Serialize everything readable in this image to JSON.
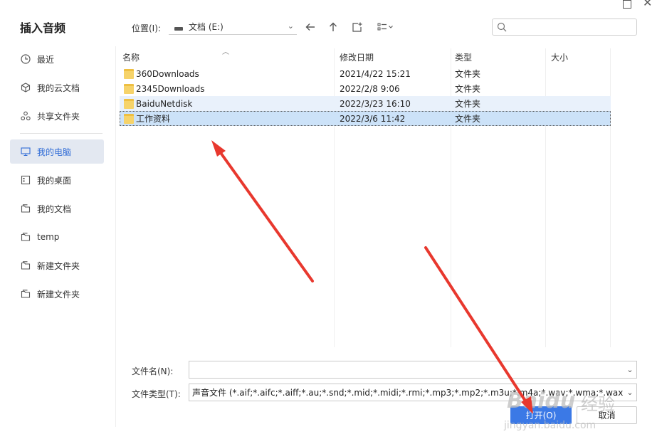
{
  "dialog": {
    "title": "插入音频"
  },
  "sidebar": {
    "items": [
      {
        "label": "最近",
        "icon": "clock-icon"
      },
      {
        "label": "我的云文档",
        "icon": "cloud-cube-icon"
      },
      {
        "label": "共享文件夹",
        "icon": "share-icon"
      },
      {
        "label": "我的电脑",
        "icon": "monitor-icon",
        "active": true
      },
      {
        "label": "我的桌面",
        "icon": "desktop-icon"
      },
      {
        "label": "我的文档",
        "icon": "folder-outline-icon"
      },
      {
        "label": "temp",
        "icon": "folder-outline-icon"
      },
      {
        "label": "新建文件夹",
        "icon": "folder-outline-icon"
      },
      {
        "label": "新建文件夹",
        "icon": "folder-outline-icon"
      }
    ]
  },
  "toolbar": {
    "location_label": "位置(I):",
    "location_value": "文档 (E:)"
  },
  "file_list": {
    "columns": [
      "名称",
      "修改日期",
      "类型",
      "大小"
    ],
    "rows": [
      {
        "name": "360Downloads",
        "modified": "2021/4/22 15:21",
        "type": "文件夹",
        "size": ""
      },
      {
        "name": "2345Downloads",
        "modified": "2022/2/8 9:06",
        "type": "文件夹",
        "size": ""
      },
      {
        "name": "BaiduNetdisk",
        "modified": "2022/3/23 16:10",
        "type": "文件夹",
        "size": ""
      },
      {
        "name": "工作资料",
        "modified": "2022/3/6 11:42",
        "type": "文件夹",
        "size": ""
      }
    ]
  },
  "form": {
    "filename_label": "文件名(N):",
    "filename_value": "",
    "filetype_label": "文件类型(T):",
    "filetype_value": "声音文件 (*.aif;*.aifc;*.aiff;*.au;*.snd;*.mid;*.midi;*.rmi;*.mp3;*.mp2;*.m3u;*.m4a;*.wav;*.wma;*.wax)"
  },
  "buttons": {
    "open": "打开(O)",
    "cancel": "取消"
  },
  "watermark": {
    "brand": "Baidu",
    "suffix": "经验",
    "url": "jingyan.baidu.com"
  },
  "colors": {
    "accent": "#3b79e6",
    "selection": "#cce2f8",
    "hover": "#e9f1fb",
    "arrow": "#e8382e"
  }
}
